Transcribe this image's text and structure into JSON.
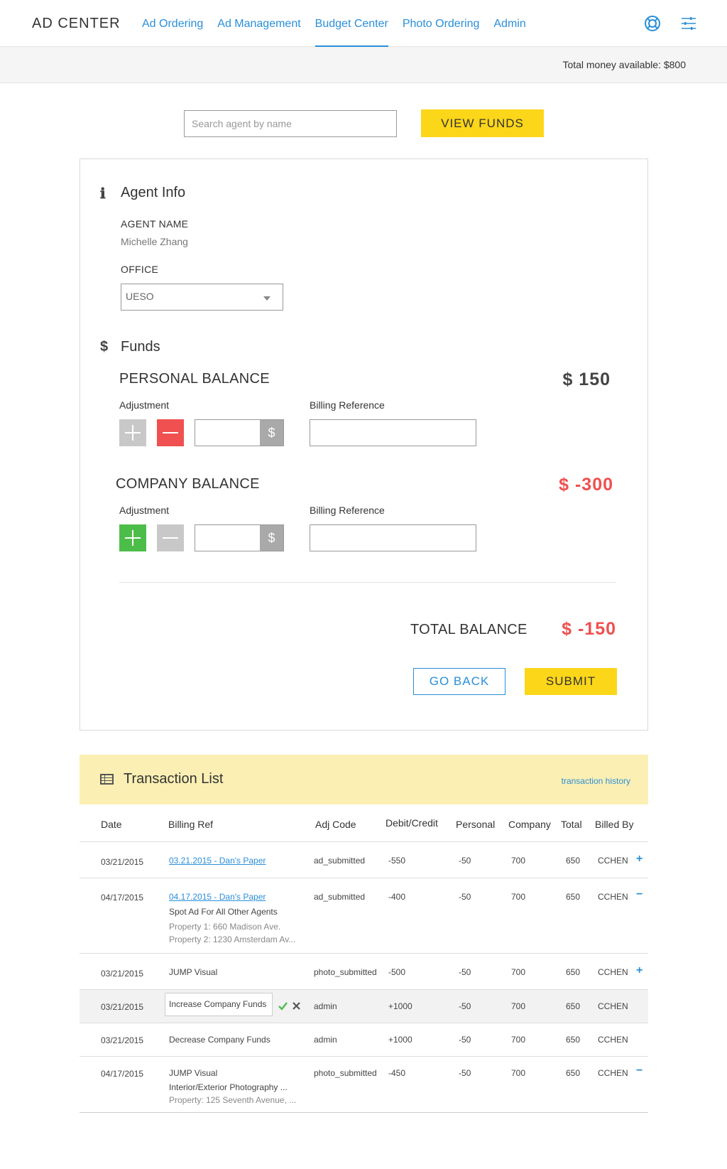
{
  "header": {
    "brand": "AD CENTER",
    "nav": [
      "Ad Ordering",
      "Ad Management",
      "Budget Center",
      "Photo Ordering",
      "Admin"
    ],
    "active_nav": "Budget Center",
    "icons": [
      "lifebuoy-icon",
      "sliders-icon"
    ]
  },
  "money_bar": {
    "text": "Total money available: $800"
  },
  "search": {
    "placeholder": "Search agent by name",
    "button": "VIEW FUNDS"
  },
  "agent_info": {
    "title": "Agent Info",
    "agent_name_label": "AGENT NAME",
    "agent_name": "Michelle Zhang",
    "office_label": "OFFICE",
    "office_value": "UESO"
  },
  "funds": {
    "title": "Funds",
    "personal": {
      "label": "PERSONAL BALANCE",
      "value": "$ 150",
      "adjust_label": "Adjustment",
      "ref_label": "Billing Reference",
      "dollar": "$"
    },
    "company": {
      "label": "COMPANY BALANCE",
      "value": "$ -300",
      "adjust_label": "Adjustment",
      "ref_label": "Billing Reference",
      "dollar": "$"
    },
    "total": {
      "label": "TOTAL BALANCE",
      "value": "$ -150"
    },
    "go_back": "GO BACK",
    "submit": "SUBMIT"
  },
  "colors": {
    "accent": "#2a8fd8",
    "yellow": "#fcd619",
    "negative": "#f0504f",
    "positive": "#4dbd4a",
    "tx_header_bg": "#fbefb3"
  },
  "transactions": {
    "title": "Transaction List",
    "history_link": "transaction history",
    "columns": [
      "Date",
      "Billing Ref",
      "Adj Code",
      "Debit/Credit",
      "Personal",
      "Company",
      "Total",
      "Billed By"
    ],
    "rows": [
      {
        "date": "03/21/2015",
        "ref": "03.21.2015 - Dan's Paper",
        "ref_link": true,
        "code": "ad_submitted",
        "dc": "-550",
        "personal": "-50",
        "company": "700",
        "total": "650",
        "by": "CCHEN",
        "toggle": "+"
      },
      {
        "date": "04/17/2015",
        "ref": "04.17.2015 - Dan's Paper",
        "ref_link": true,
        "sub": "Spot Ad For All Other Agents",
        "sub2": "Property 1: 660 Madison Ave.",
        "sub3": "Property 2: 1230 Amsterdam Av...",
        "code": "ad_submitted",
        "dc": "-400",
        "personal": "-50",
        "company": "700",
        "total": "650",
        "by": "CCHEN",
        "toggle": "−"
      },
      {
        "date": "03/21/2015",
        "ref": "JUMP Visual",
        "code": "photo_submitted",
        "dc": "-500",
        "personal": "-50",
        "company": "700",
        "total": "650",
        "by": "CCHEN",
        "toggle": "+"
      },
      {
        "date": "03/21/2015",
        "ref": "Increase Company Funds",
        "editing": true,
        "code": "admin",
        "dc": "+1000",
        "personal": "-50",
        "company": "700",
        "total": "650",
        "by": "CCHEN"
      },
      {
        "date": "03/21/2015",
        "ref": "Decrease Company Funds",
        "code": "admin",
        "dc": "+1000",
        "personal": "-50",
        "company": "700",
        "total": "650",
        "by": "CCHEN"
      },
      {
        "date": "04/17/2015",
        "ref": "JUMP Visual",
        "sub": "Interior/Exterior Photography ...",
        "sub2": "Property: 125 Seventh Avenue, ...",
        "code": "photo_submitted",
        "dc": "-450",
        "personal": "-50",
        "company": "700",
        "total": "650",
        "by": "CCHEN",
        "toggle": "−"
      }
    ]
  }
}
